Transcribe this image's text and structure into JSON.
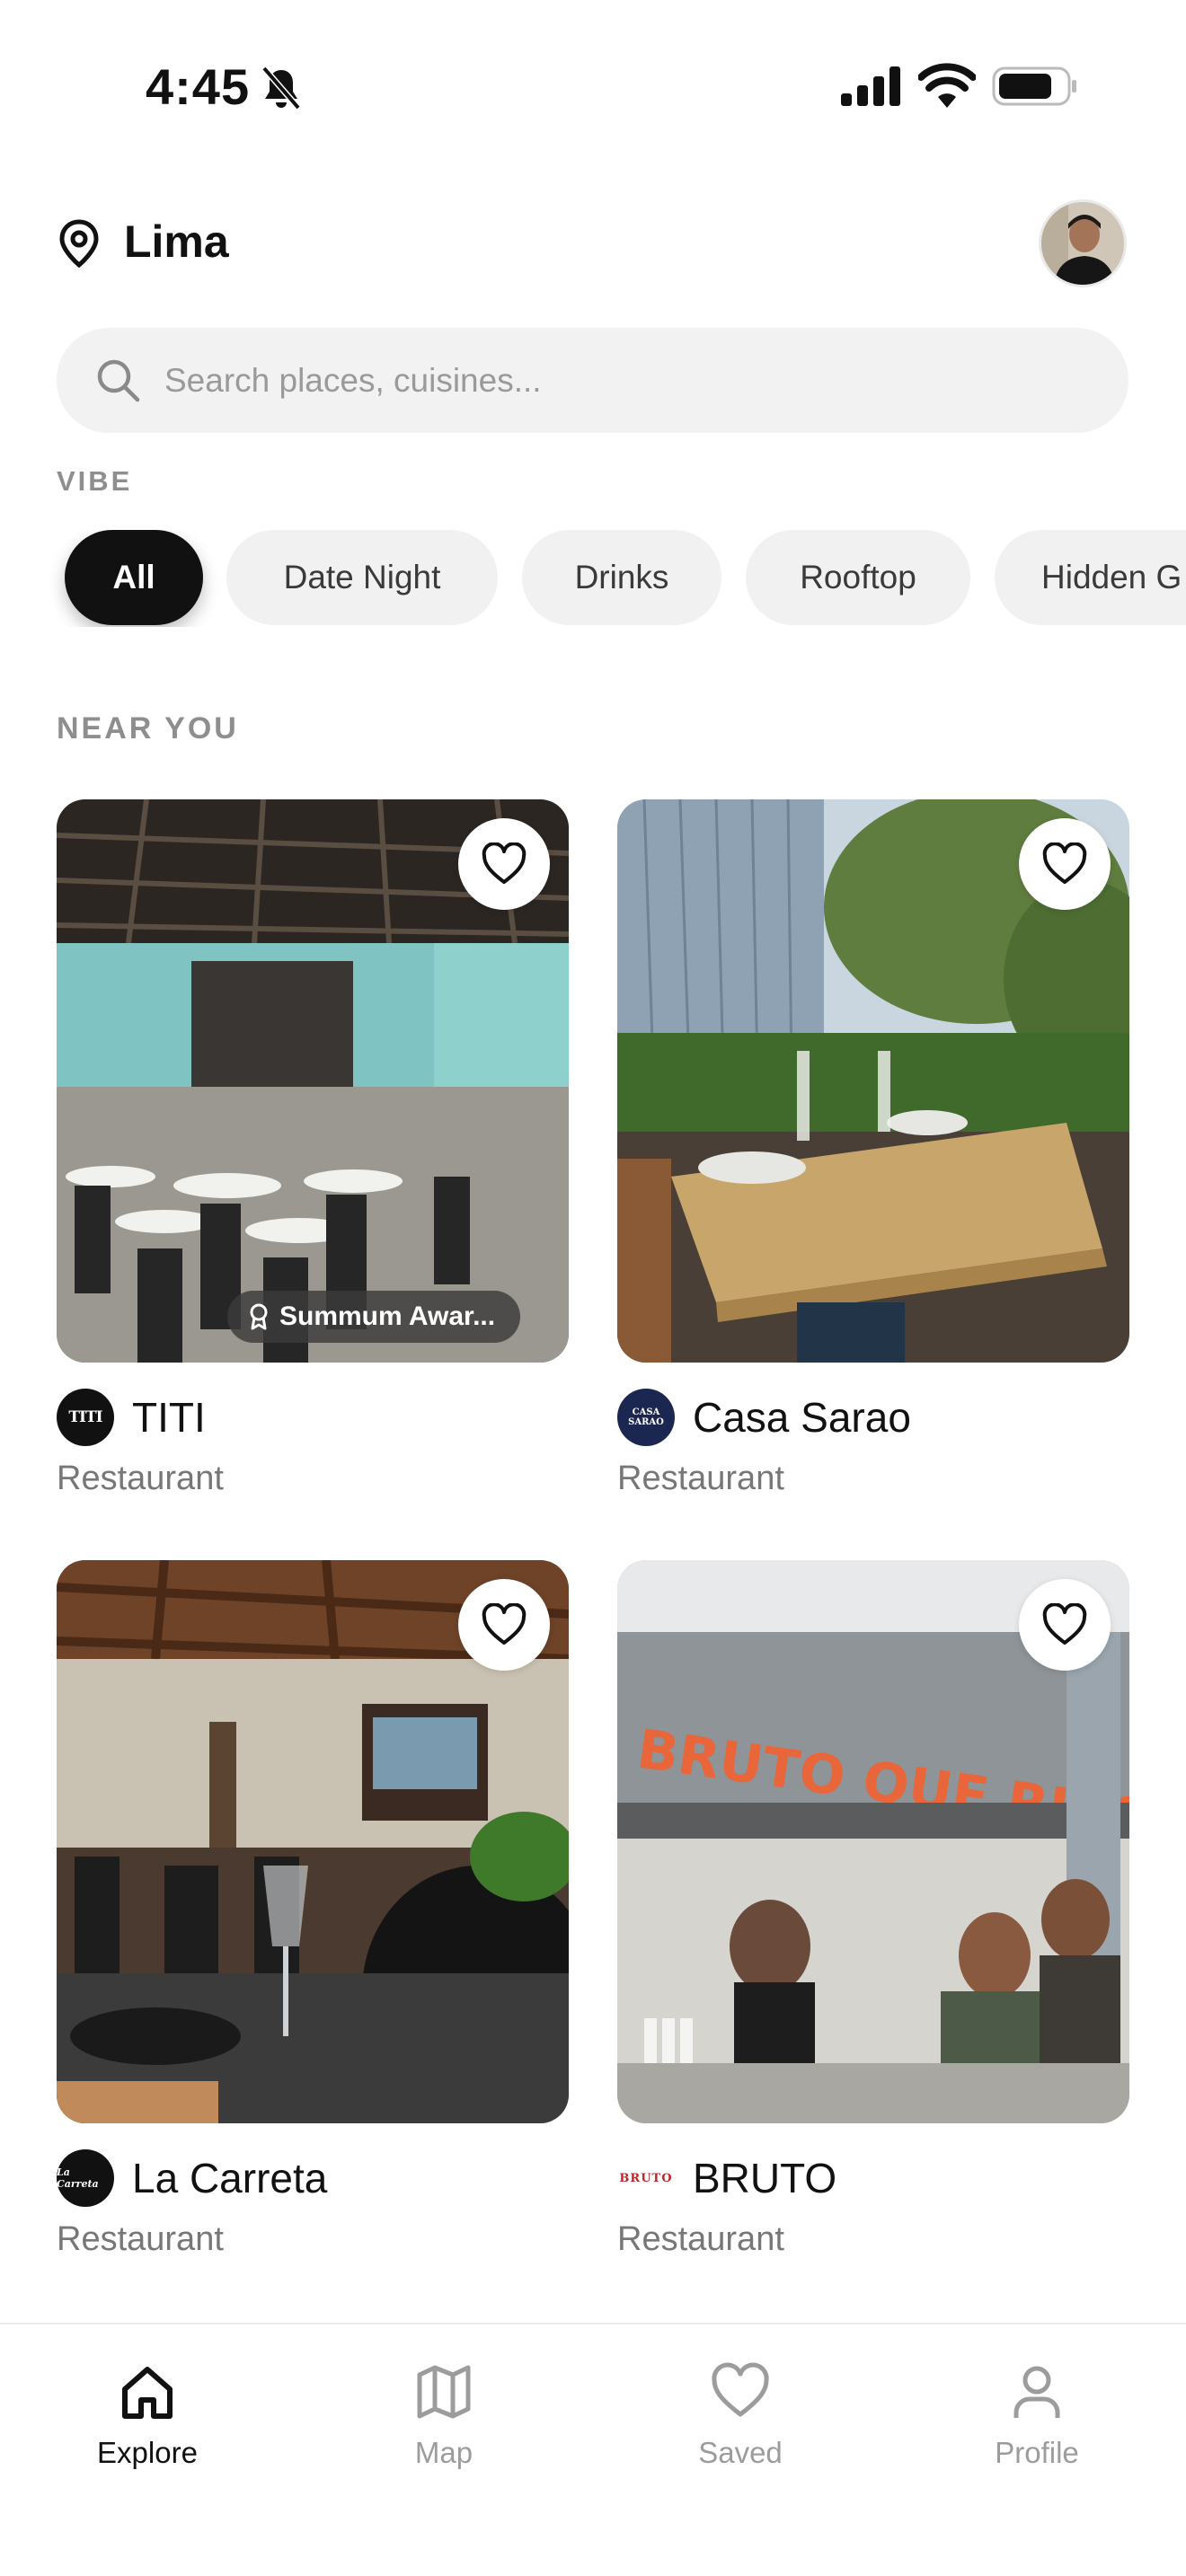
{
  "status_bar": {
    "time": "4:45"
  },
  "header": {
    "city": "Lima"
  },
  "search": {
    "placeholder": "Search places, cuisines..."
  },
  "vibe": {
    "label": "VIBE",
    "chips": [
      {
        "label": "All",
        "active": true
      },
      {
        "label": "Date Night",
        "active": false
      },
      {
        "label": "Drinks",
        "active": false
      },
      {
        "label": "Rooftop",
        "active": false
      },
      {
        "label": "Hidden G",
        "active": false
      }
    ]
  },
  "near_you": {
    "label": "NEAR YOU",
    "places": [
      {
        "name": "TITI",
        "type": "Restaurant",
        "logo_text": "TITI",
        "badge": "Summum Awar..."
      },
      {
        "name": "Casa Sarao",
        "type": "Restaurant",
        "logo_text": "CASA SARAO"
      },
      {
        "name": "La Carreta",
        "type": "Restaurant",
        "logo_text": "La Carreta"
      },
      {
        "name": "BRUTO",
        "type": "Restaurant",
        "logo_text": "BRUTO"
      }
    ]
  },
  "tabs": [
    {
      "label": "Explore",
      "icon": "home-icon",
      "active": true
    },
    {
      "label": "Map",
      "icon": "map-icon",
      "active": false
    },
    {
      "label": "Saved",
      "icon": "heart-icon",
      "active": false
    },
    {
      "label": "Profile",
      "icon": "person-icon",
      "active": false
    }
  ],
  "colors": {
    "text": "#111111",
    "muted": "#777777",
    "chip_bg": "#f1f1f1",
    "search_bg": "#f2f2f2",
    "active_chip": "#111111"
  }
}
